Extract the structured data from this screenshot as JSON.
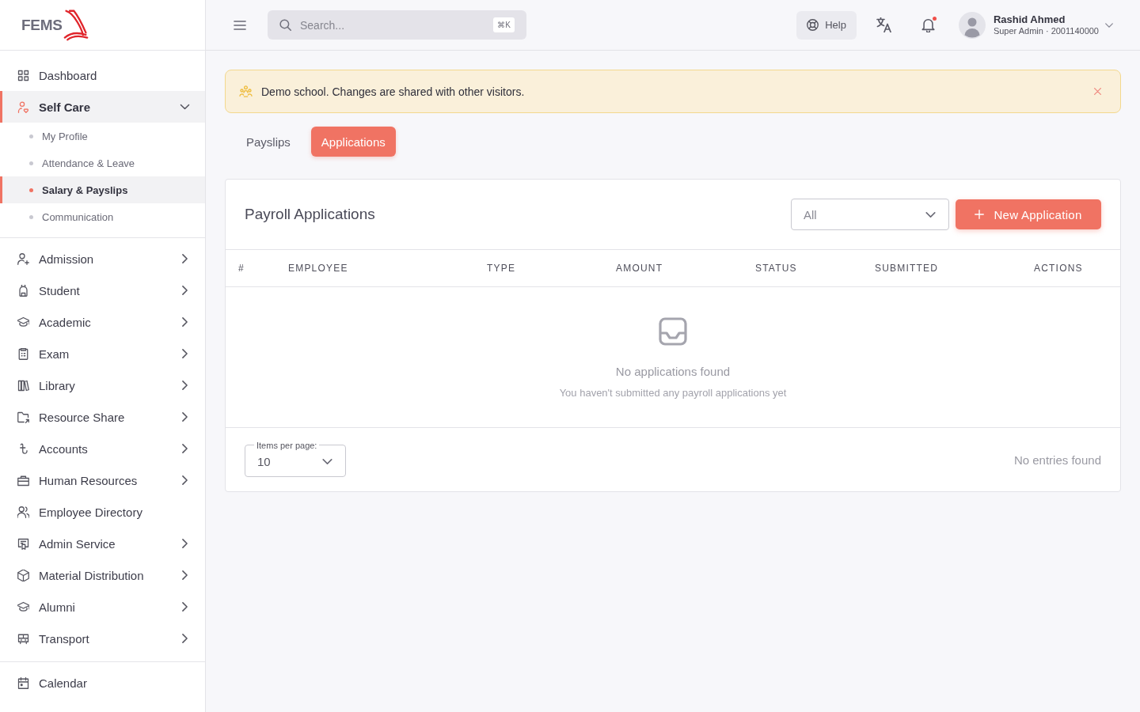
{
  "brand": {
    "logo_text": "FEMS"
  },
  "sidebar": {
    "sections": [
      {
        "items": [
          {
            "label": "Dashboard",
            "selected": false
          },
          {
            "label": "Self Care",
            "selected": true,
            "expanded": true,
            "children": [
              {
                "label": "My Profile",
                "selected": false
              },
              {
                "label": "Attendance & Leave",
                "selected": false
              },
              {
                "label": "Salary & Payslips",
                "selected": true
              },
              {
                "label": "Communication",
                "selected": false
              }
            ]
          }
        ]
      },
      {
        "items": [
          {
            "label": "Admission",
            "selected": false,
            "expanded": false
          },
          {
            "label": "Student",
            "selected": false,
            "expanded": false
          },
          {
            "label": "Academic",
            "selected": false,
            "expanded": false
          },
          {
            "label": "Exam",
            "selected": false,
            "expanded": false
          },
          {
            "label": "Library",
            "selected": false,
            "expanded": false
          },
          {
            "label": "Resource Share",
            "selected": false,
            "expanded": false
          },
          {
            "label": "Accounts",
            "selected": false,
            "expanded": false
          },
          {
            "label": "Human Resources",
            "selected": false,
            "expanded": false
          },
          {
            "label": "Employee Directory",
            "selected": false
          },
          {
            "label": "Admin Service",
            "selected": false,
            "expanded": false
          },
          {
            "label": "Material Distribution",
            "selected": false,
            "expanded": false
          },
          {
            "label": "Alumni",
            "selected": false,
            "expanded": false
          },
          {
            "label": "Transport",
            "selected": false,
            "expanded": false
          }
        ]
      },
      {
        "items": [
          {
            "label": "Calendar",
            "selected": false
          }
        ]
      }
    ]
  },
  "topbar": {
    "search": {
      "placeholder": "Search...",
      "shortcut": "⌘K"
    },
    "help": "Help",
    "notifications": {
      "unread": true
    },
    "user": {
      "name": "Rashid Ahmed",
      "role": "Super Admin · 2001140000"
    }
  },
  "banner": {
    "message": "Demo school. Changes are shared with other visitors.",
    "dismissible": true
  },
  "tabs": [
    {
      "label": "Payslips",
      "selected": false
    },
    {
      "label": "Applications",
      "selected": true
    }
  ],
  "card": {
    "title": "Payroll Applications",
    "filter": {
      "value": "All"
    },
    "new_button": "New Application",
    "table": {
      "columns": [
        "#",
        "EMPLOYEE",
        "TYPE",
        "AMOUNT",
        "STATUS",
        "SUBMITTED",
        "ACTIONS"
      ]
    },
    "empty_state": {
      "title": "No applications found",
      "message": "You haven't submitted any payroll applications yet"
    },
    "footer": {
      "items_per_page": {
        "label": "Items per page:",
        "value": "10"
      },
      "summary": "No entries found"
    }
  }
}
